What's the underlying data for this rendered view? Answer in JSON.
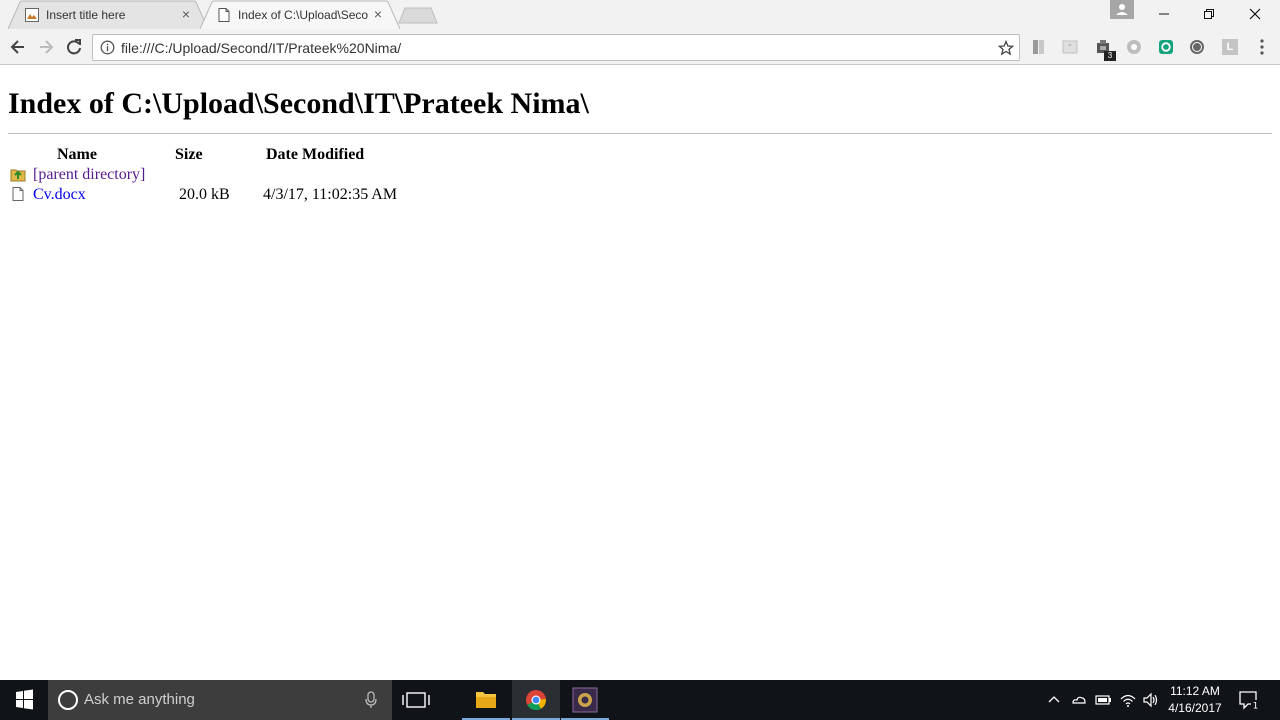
{
  "tabs": [
    {
      "title": "Insert title here",
      "close_icon": "×"
    },
    {
      "title": "Index of C:\\Upload\\Second\\IT\\Prateek Nima\\",
      "close_icon": "×"
    }
  ],
  "address_bar": {
    "url": "file:///C:/Upload/Second/IT/Prateek%20Nima/"
  },
  "extensions": {
    "badge_count": "3",
    "letter_ext": "L"
  },
  "page": {
    "heading": "Index of C:\\Upload\\Second\\IT\\Prateek Nima\\",
    "columns": {
      "name": "Name",
      "size": "Size",
      "date": "Date Modified"
    },
    "parent_link": "[parent directory]",
    "files": [
      {
        "name": "Cv.docx",
        "size": "20.0 kB",
        "date": "4/3/17, 11:02:35 AM"
      }
    ]
  },
  "taskbar": {
    "search_placeholder": "Ask me anything",
    "time": "11:12 AM",
    "date": "4/16/2017",
    "notification_count": "1"
  },
  "colors": {
    "link": "#0000ee",
    "visited_link": "#551a8b",
    "taskbar": "#101418",
    "accent": "#7aa8d8"
  }
}
